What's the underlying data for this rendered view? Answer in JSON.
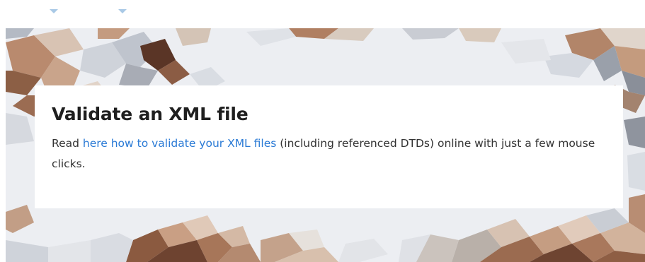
{
  "nav": {
    "items": [
      {
        "icon": "chevron-down-icon"
      },
      {
        "icon": "chevron-down-icon"
      }
    ]
  },
  "hero": {
    "background": "low-poly mosaic in brown, beige and pale blue-grey tones"
  },
  "card": {
    "title": "Validate an XML file",
    "text_before": "Read ",
    "link_text": "here how to validate your XML files",
    "text_after": " (including referenced DTDs) online with just a few mouse clicks."
  },
  "colors": {
    "link": "#2a7ad5",
    "title": "#1f1f1f",
    "body_text": "#333333",
    "nav_caret": "#a9c9e6"
  }
}
